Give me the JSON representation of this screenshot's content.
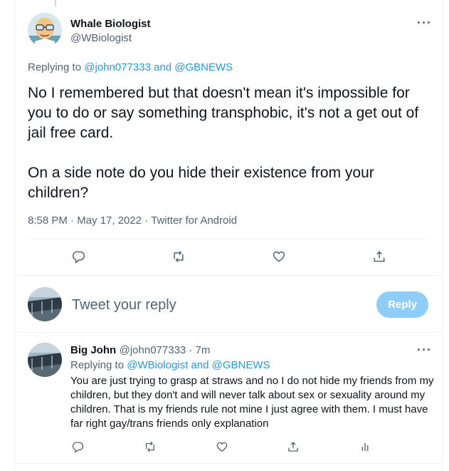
{
  "main_tweet": {
    "display_name": "Whale Biologist",
    "handle": "@WBiologist",
    "replying_prefix": "Replying to ",
    "replying_targets": "@john077333 and @GBNEWS",
    "paragraph_1": "No I remembered but that doesn't mean it's impossible for you to do or say something transphobic, it's not a get out of jail free card.",
    "paragraph_2": "On a side note do you hide their existence from your children?",
    "timestamp": "8:58 PM · May 17, 2022 · Twitter for Android",
    "actions": [
      "reply-icon",
      "retweet-icon",
      "like-icon",
      "share-icon"
    ]
  },
  "compose": {
    "placeholder": "Tweet your reply",
    "button_label": "Reply",
    "button_color": "#8ecdf8"
  },
  "reply_tweet": {
    "display_name": "Big John",
    "handle_time": "@john077333 · 7m",
    "replying_prefix": "Replying to ",
    "replying_targets": "@WBiologist and @GBNEWS",
    "text": "You are just trying to grasp at straws and no I do not hide my friends from my children, but they don't and will never talk about sex or sexuality around my children. That is my friends rule not mine I just agree with them. I must have far right gay/trans friends only explanation",
    "actions": [
      "reply-icon",
      "retweet-icon",
      "like-icon",
      "share-icon",
      "analytics-icon"
    ]
  },
  "colors": {
    "link": "#1d9bf0",
    "secondary_text": "#536471",
    "primary_text": "#0f1419",
    "divider": "#eff3f4"
  }
}
